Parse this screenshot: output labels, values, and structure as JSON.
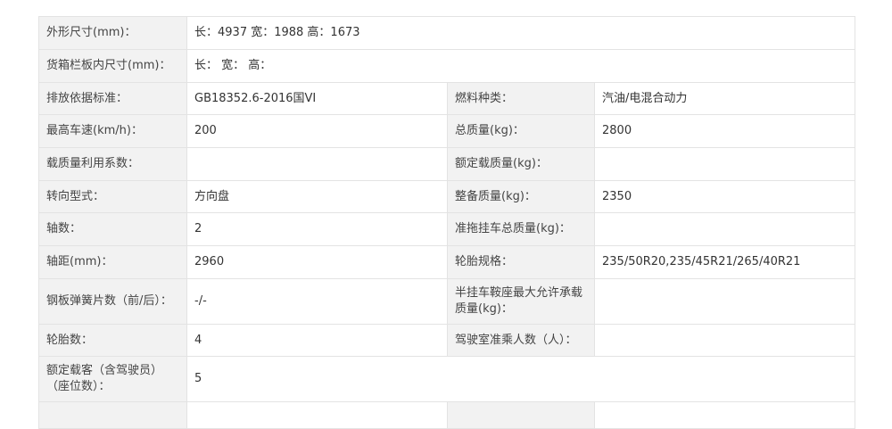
{
  "rows": [
    {
      "l1": "外形尺寸(mm)：",
      "v1": "长：4937 宽：1988 高：1673",
      "full": true
    },
    {
      "l1": "货箱栏板内尺寸(mm)：",
      "v1": "长： 宽： 高：",
      "full": true
    },
    {
      "l1": "排放依据标准：",
      "v1": "GB18352.6-2016国VI",
      "l2": "燃料种类：",
      "v2": "汽油/电混合动力"
    },
    {
      "l1": "最高车速(km/h)：",
      "v1": "200",
      "l2": "总质量(kg)：",
      "v2": "2800"
    },
    {
      "l1": "载质量利用系数：",
      "v1": "",
      "l2": "额定载质量(kg)：",
      "v2": ""
    },
    {
      "l1": "转向型式：",
      "v1": "方向盘",
      "l2": "整备质量(kg)：",
      "v2": "2350"
    },
    {
      "l1": "轴数：",
      "v1": "2",
      "l2": "准拖挂车总质量(kg)：",
      "v2": ""
    },
    {
      "l1": "轴距(mm)：",
      "v1": "2960",
      "l2": "轮胎规格：",
      "v2": "235/50R20,235/45R21/265/40R21"
    },
    {
      "l1": "钢板弹簧片数（前/后）：",
      "v1": "-/-",
      "l2": "半挂车鞍座最大允许承载质量(kg)：",
      "v2": ""
    },
    {
      "l1": "轮胎数：",
      "v1": "4",
      "l2": "驾驶室准乘人数（人）：",
      "v2": ""
    },
    {
      "l1": "额定载客（含驾驶员）（座位数）：",
      "v1": "5",
      "full": true
    }
  ]
}
